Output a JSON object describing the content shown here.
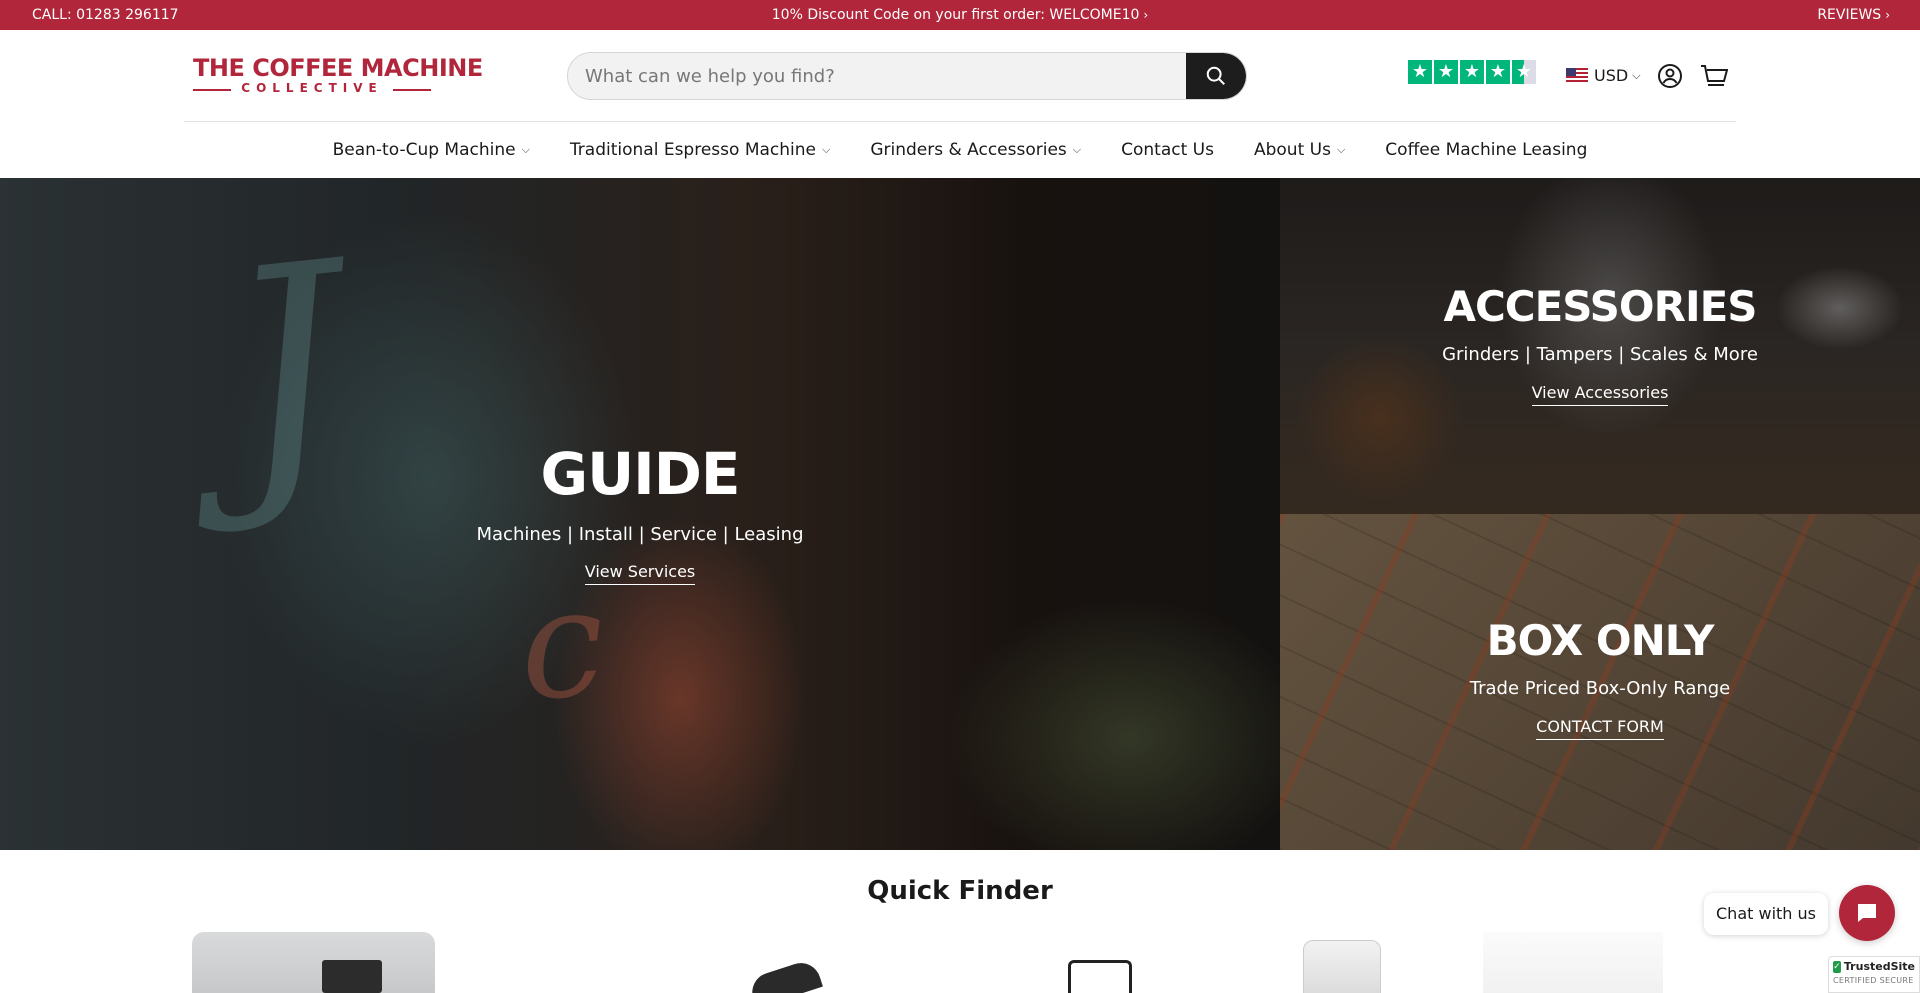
{
  "announcement": {
    "phone": "CALL: 01283 296117",
    "promo": "10% Discount Code on your first order: WELCOME10",
    "reviews": "REVIEWS"
  },
  "header": {
    "logo_line1": "THE COFFEE MACHINE",
    "logo_line2": "COLLECTIVE",
    "search_placeholder": "What can we help you find?",
    "currency": "USD",
    "colors": {
      "brand": "#b1263a",
      "trustpilot": "#00b67a"
    }
  },
  "nav": {
    "items": [
      {
        "label": "Bean-to-Cup Machine",
        "dropdown": true
      },
      {
        "label": "Traditional Espresso Machine",
        "dropdown": true
      },
      {
        "label": "Grinders & Accessories",
        "dropdown": true
      },
      {
        "label": "Contact Us",
        "dropdown": false
      },
      {
        "label": "About Us",
        "dropdown": true
      },
      {
        "label": "Coffee Machine Leasing",
        "dropdown": false
      }
    ]
  },
  "hero": {
    "guide": {
      "title": "GUIDE",
      "subtitle": "Machines | Install | Service | Leasing",
      "link": "View Services"
    },
    "accessories": {
      "title": "ACCESSORIES",
      "subtitle": "Grinders | Tampers | Scales & More",
      "link": "View Accessories"
    },
    "box_only": {
      "title": "BOX ONLY",
      "subtitle": "Trade Priced Box-Only Range",
      "link": "CONTACT FORM"
    }
  },
  "quick_finder": {
    "title": "Quick Finder"
  },
  "chat": {
    "label": "Chat with us"
  },
  "trusted_site": {
    "name": "TrustedSite",
    "tagline": "CERTIFIED SECURE"
  }
}
